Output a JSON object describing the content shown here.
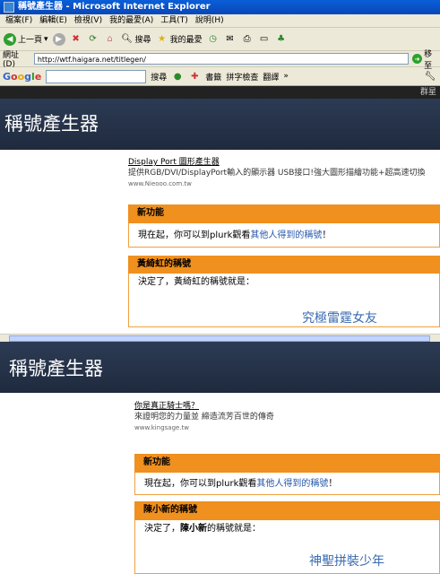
{
  "window": {
    "title": "稱號產生器 - Microsoft Internet Explorer"
  },
  "menu": [
    "檔案(F)",
    "編輯(E)",
    "檢視(V)",
    "我的最愛(A)",
    "工具(T)",
    "說明(H)"
  ],
  "toolbar": {
    "back": "上一頁",
    "search": "搜尋",
    "favorites": "我的最愛"
  },
  "address": {
    "label": "網址(D)",
    "url": "http://wtf.haigara.net/titlegen/",
    "go": "移至"
  },
  "googlebar": {
    "logo": "Google",
    "search": "搜尋",
    "bookmarks": "書籤",
    "spellcheck": "拼字檢查",
    "translate": "翻譯"
  },
  "topbar": {
    "right_text": "群星"
  },
  "site": {
    "title": "稱號產生器"
  },
  "first": {
    "ad": {
      "title": "Display Port 圖形產生器",
      "desc": "提供RGB/DVI/DisplayPort輸入的顯示器 USB接口!強大圖形描繪功能+超高速切換",
      "url": "www.Nieooo.com.tw"
    },
    "news_head": "新功能",
    "news_text": "現在起，你可以到plurk觀看",
    "news_link": "其他人得到的稱號",
    "news_end": "！",
    "result_head": "黃綺虹的稱號",
    "result_text": "決定了，黃綺虹的稱號就是：",
    "result_title": "究極雷霆女友"
  },
  "second": {
    "site_title": "稱號產生器",
    "ad": {
      "title": "你是真正騎士嗎？",
      "desc": "來證明您的力量並 締造流芳百世的傳奇",
      "url": "www.kingsage.tw"
    },
    "news_head": "新功能",
    "news_text": "現在起，你可以到plurk觀看",
    "news_link": "其他人得到的稱號",
    "news_end": "！",
    "result_head": "陳小新的稱號",
    "result_pre": "決定了，",
    "result_name": "陳小新",
    "result_post": "的稱號就是：",
    "result_title": "神聖拼裝少年"
  }
}
